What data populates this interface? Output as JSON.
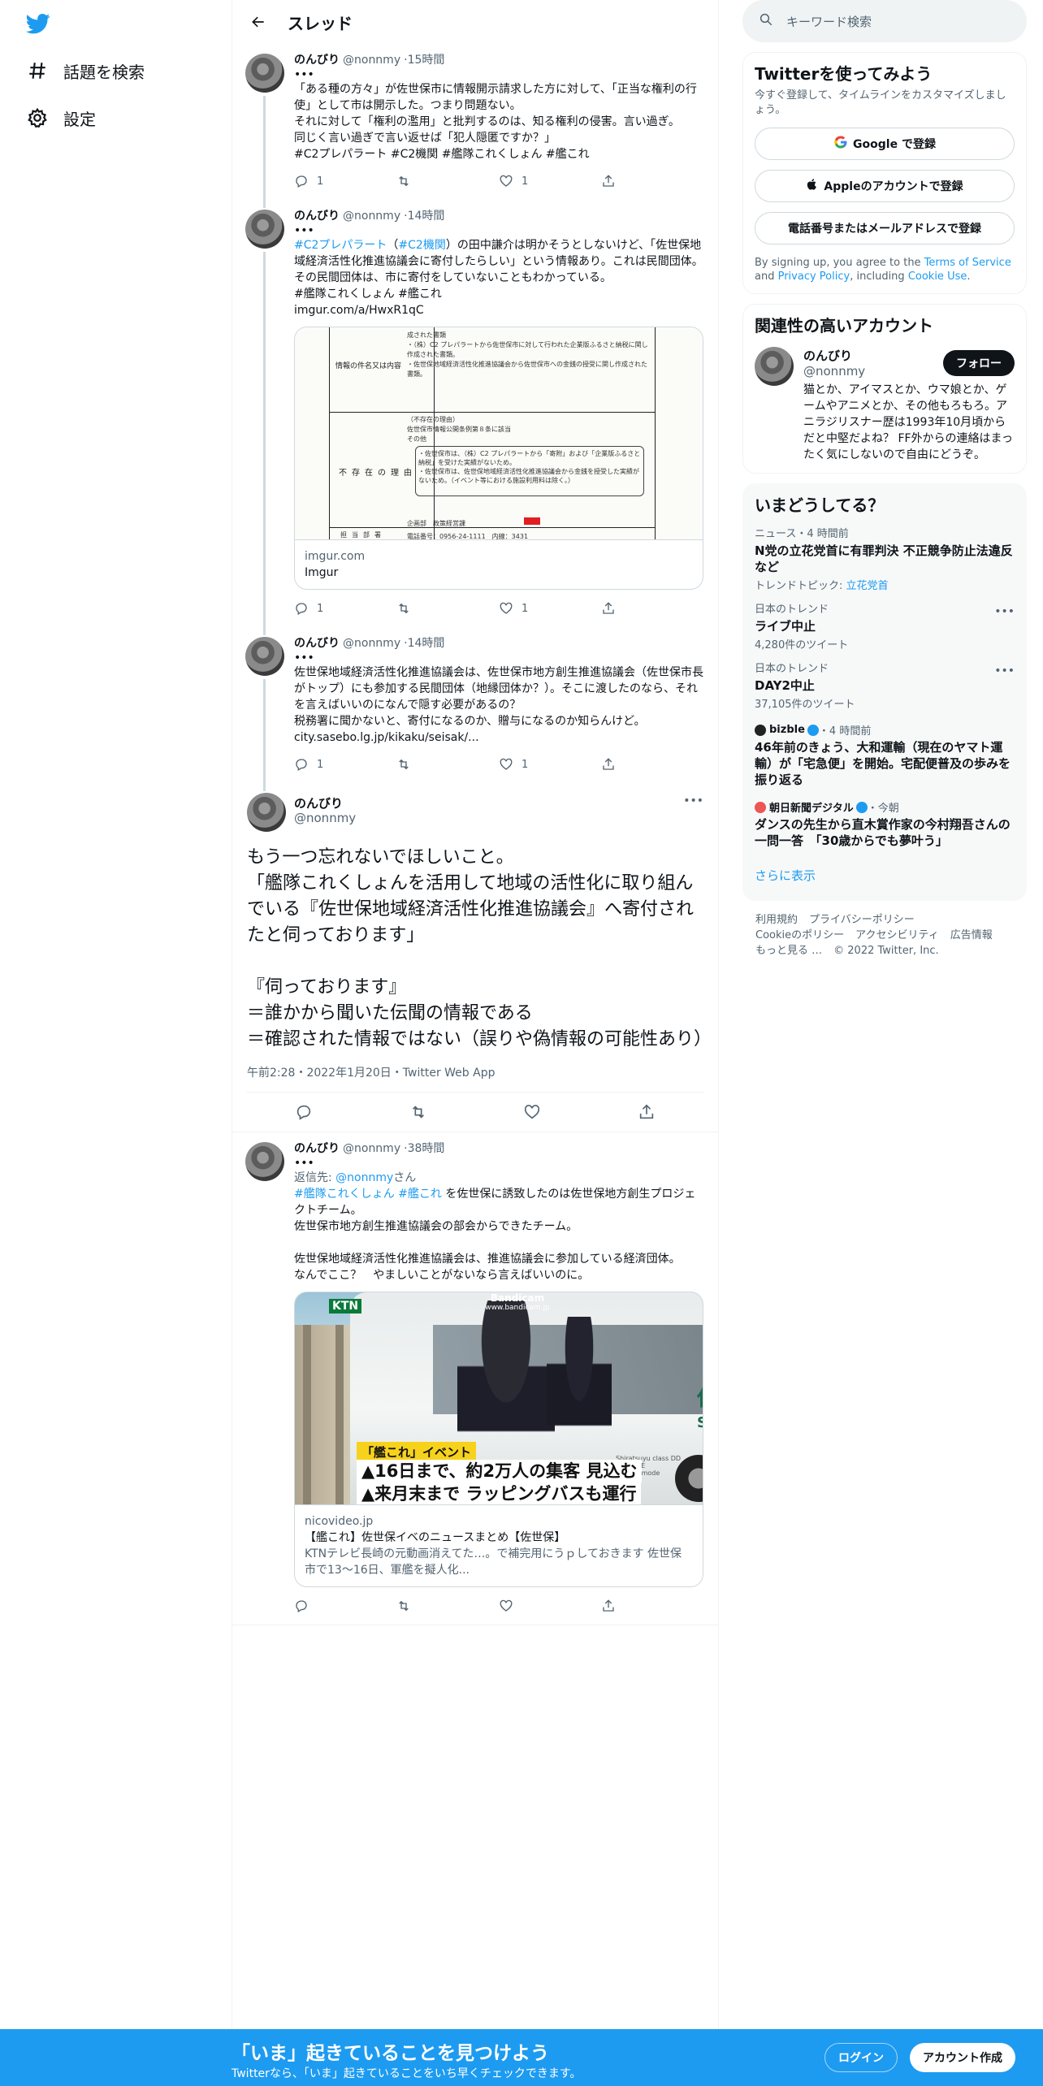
{
  "nav": {
    "explore_label": "話題を検索",
    "settings_label": "設定"
  },
  "header": {
    "title": "スレッド"
  },
  "tweets": [
    {
      "name": "のんびり",
      "handle": "@nonnmy",
      "time": "15時間",
      "text": "「ある種の方々」が佐世保市に情報開示請求した方に対して、「正当な権利の行使」として市は開示した。つまり問題ない。\nそれに対して「権利の濫用」と批判するのは、知る権利の侵害。言い過ぎ。\n同じく言い過ぎで言い返せば「犯人隠匿ですか？」",
      "hashtags": "#C2プレパラート #C2機関 #艦隊これくしょん #艦これ",
      "replies": "1",
      "retweets": "",
      "likes": "1"
    },
    {
      "name": "のんびり",
      "handle": "@nonnmy",
      "time": "14時間",
      "text_pre_tag1": "#C2プレパラート",
      "text_paren_open": "（",
      "text_pre_tag2": "#C2機関",
      "text_main": "）の田中謙介は明かそうとしないけど、「佐世保地域経済活性化推進協議会に寄付したらしい」という情報あり。これは民間団体。\nその民間団体は、市に寄付をしていないこともわかっている。",
      "hashtags": "#艦隊これくしょん #艦これ",
      "link": "imgur.com/a/HwxR1qC",
      "card_domain": "imgur.com",
      "card_title": "Imgur",
      "doc_lines": [
        "情報の件名又は内容",
        "成された書類",
        "・（株）C2 プレパラートから佐世保市に対して行われた企業版ふるさと納税に関し作成された書類。",
        "・佐世保地域経済活性化推進協議会から佐世保市への金銭の授受に関し作成された書類。",
        "不存在の理由",
        "（不存在の理由）",
        "佐世保市情報公開条例第８条に該当",
        "その他",
        "・佐世保市は、（株）C2 プレパラートから「寄附」および「企業版ふるさと納税」を受けた実績がないため。",
        "・佐世保市は、佐世保地域経済活性化推進協議会から金銭を授受した実績がないため。（イベント等における施設利用料は除く。）",
        "企画部　政策経営課",
        "担当部署",
        "電話番号：0956-24-1111　内線：3431"
      ],
      "replies": "1",
      "retweets": "",
      "likes": "1"
    },
    {
      "name": "のんびり",
      "handle": "@nonnmy",
      "time": "14時間",
      "text": "佐世保地域経済活性化推進協議会は、佐世保市地方創生推進協議会（佐世保市長がトップ）にも参加する民間団体（地縁団体か？）。そこに渡したのなら、それを言えばいいのになんで隠す必要があるの？\n税務署に聞かないと、寄付になるのか、贈与になるのか知らんけど。",
      "link": "city.sasebo.lg.jp/kikaku/seisak/...",
      "replies": "1",
      "retweets": "",
      "likes": "1"
    }
  ],
  "focal": {
    "name": "のんびり",
    "handle": "@nonnmy",
    "text": "もう一つ忘れないでほしいこと。\n「艦隊これくしょんを活用して地域の活性化に取り組んでいる『佐世保地域経済活性化推進協議会』へ寄付されたと伺っております」\n\n『伺っております』\n＝誰かから聞いた伝聞の情報である\n＝確認された情報ではない（誤りや偽情報の可能性あり）",
    "meta": "午前2:28・2022年1月20日・Twitter Web App"
  },
  "reply": {
    "name": "のんびり",
    "handle": "@nonnmy",
    "time": "38時間",
    "reply_to_prefix": "返信先: ",
    "reply_to_handle": "@nonnmy",
    "reply_to_suffix": "さん",
    "hashtags": "#艦隊これくしょん #艦これ",
    "text_after_tags": " を佐世保に誘致したのは佐世保地方創生プロジェクトチーム。\n佐世保市地方創生推進協議会の部会からできたチーム。\n\n佐世保地域経済活性化推進協議会は、推進協議会に参加している経済団体。\nなんでここ？　やましいことがないなら言えばいいのに。",
    "card_domain": "nicovideo.jp",
    "card_title": "【艦これ】佐世保イベのニュースまとめ【佐世保】",
    "card_desc": "KTNテレビ長崎の元動画消えてた…。で補完用にうｐしておきます 佐世保市で13～16日、軍艦を擬人化...",
    "thumb_logo": "KTN",
    "thumb_watermark": "Bandicam",
    "thumb_watermark_url": "www.bandicam.jp",
    "thumb_tag": "「艦これ」イベント",
    "thumb_line1": "▲16日まで、約2万人の集客 見込む",
    "thumb_line2": "▲来月末まで ラッピングバスも運行",
    "thumb_bus_text": "佐",
    "thumb_bus_text2": "SA",
    "thumb_bus_small": "Shiratsuyu class DD SHIGURE",
    "thumb_bus_small2": "Sasebo mode"
  },
  "sidebar": {
    "search_placeholder": "キーワード検索",
    "signup_title": "Twitterを使ってみよう",
    "signup_sub": "今すぐ登録して、タイムラインをカスタマイズしましょう。",
    "google_btn": "Google で登録",
    "apple_btn": "Appleのアカウントで登録",
    "phone_btn": "電話番号またはメールアドレスで登録",
    "terms_1": "By signing up, you agree to the ",
    "terms_link1": "Terms of Service",
    "terms_2": " and ",
    "terms_link2": "Privacy Policy",
    "terms_3": ", including ",
    "terms_link3": "Cookie Use",
    "terms_4": ".",
    "related_title": "関連性の高いアカウント",
    "acc_name": "のんびり",
    "acc_handle": "@nonnmy",
    "acc_bio": "猫とか、アイマスとか、ウマ娘とか、ゲームやアニメとか、その他もろもろ。アニラジリスナー歴は1993年10月頃からだと中堅だよね？ FF外からの連絡はまったく気にしないので自由にどうぞ。",
    "follow_btn": "フォロー",
    "trends_title": "いまどうしてる？",
    "trends": [
      {
        "meta": "ニュース・4 時間前",
        "title": "N党の立花党首に有罪判決 不正競争防止法違反など",
        "sub_prefix": "トレンドトピック: ",
        "sub_link": "立花党首"
      },
      {
        "meta": "日本のトレンド",
        "title": "ライブ中止",
        "sub": "4,280件のツイート"
      },
      {
        "meta": "日本のトレンド",
        "title": "DAY2中止",
        "sub": "37,105件のツイート"
      },
      {
        "source": "bizble",
        "time": "・4 時間前",
        "title": "46年前のきょう、大和運輸（現在のヤマト運輸）が「宅急便」を開始。宅配便普及の歩みを振り返る"
      },
      {
        "source": "朝日新聞デジタル",
        "time": "・今朝",
        "title": "ダンスの先生から直木賞作家の今村翔吾さんの一問一答　「30歳からでも夢叶う」"
      }
    ],
    "show_more": "さらに表示",
    "footer": [
      "利用規約",
      "プライバシーポリシー",
      "Cookieのポリシー",
      "アクセシビリティ",
      "広告情報",
      "もっと見る …",
      "© 2022 Twitter, Inc."
    ]
  },
  "bottom": {
    "title": "「いま」起きていることを見つけよう",
    "sub": "Twitterなら、「いま」起きていることをいち早くチェックできます。",
    "login": "ログイン",
    "signup": "アカウント作成"
  },
  "colors": {
    "accent": "#1d9bf0",
    "text": "#0f1419",
    "muted": "#536471"
  }
}
